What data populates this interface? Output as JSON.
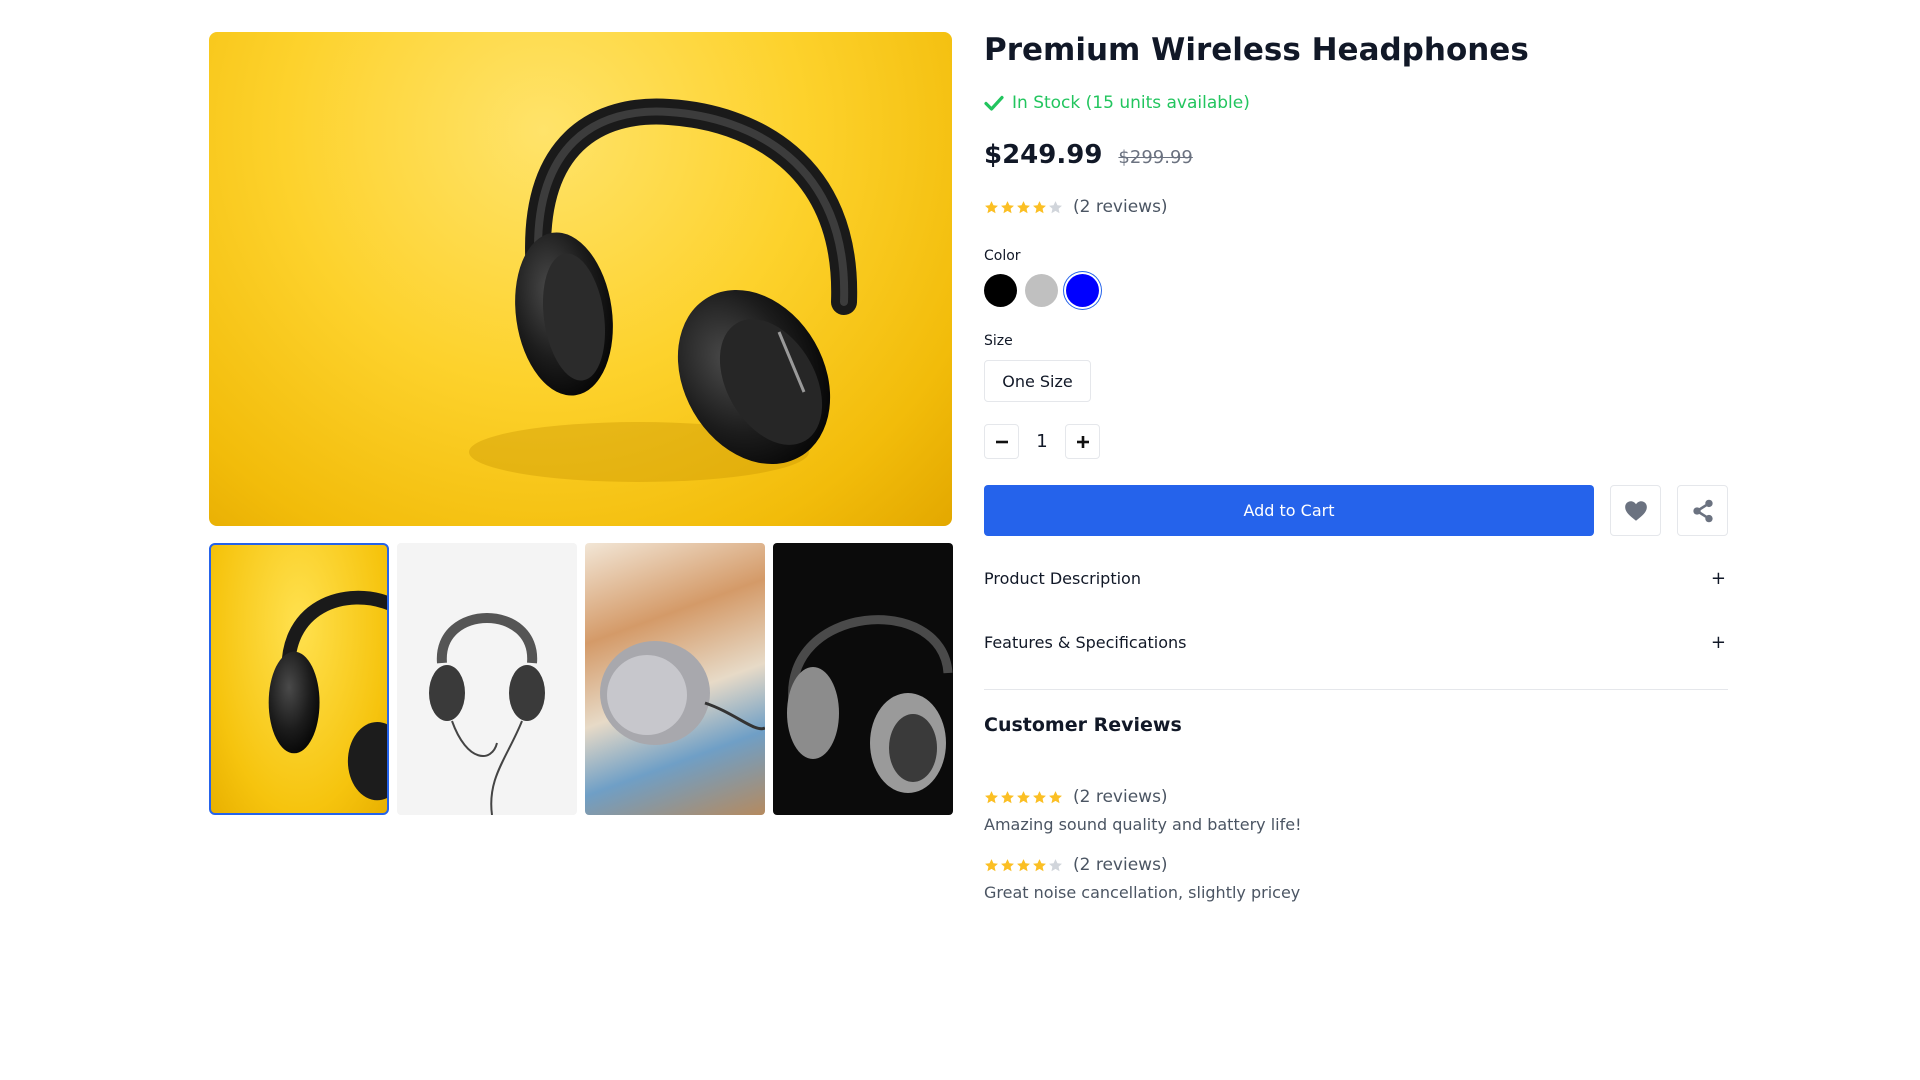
{
  "product": {
    "title": "Premium Wireless Headphones",
    "stock_text": "In Stock (15 units available)",
    "price": "$249.99",
    "old_price": "$299.99",
    "rating": 4,
    "rating_text": "(2 reviews)"
  },
  "gallery": {
    "main_image": "yellow-headphones-photo",
    "thumbnails": [
      "yellow-headphones-photo",
      "white-background-headphones-photo",
      "metal-earcup-closeup-photo",
      "black-background-headphones-photo"
    ],
    "selected_index": 0
  },
  "options": {
    "color_label": "Color",
    "colors": [
      "#000000",
      "#c0c0c0",
      "#0000ff"
    ],
    "selected_color_index": 2,
    "size_label": "Size",
    "size_value": "One Size"
  },
  "quantity": {
    "value": "1",
    "minus_icon": "minus-icon",
    "plus_icon": "plus-icon"
  },
  "actions": {
    "add_to_cart": "Add to Cart",
    "wishlist_icon": "heart-icon",
    "share_icon": "share-icon"
  },
  "accordions": {
    "description": {
      "title": "Product Description",
      "toggle": "+"
    },
    "features": {
      "title": "Features & Specifications",
      "toggle": "+"
    }
  },
  "reviews": {
    "heading": "Customer Reviews",
    "items": [
      {
        "rating": 5,
        "count_text": "(2 reviews)",
        "text": "Amazing sound quality and battery life!"
      },
      {
        "rating": 4,
        "count_text": "(2 reviews)",
        "text": "Great noise cancellation, slightly pricey"
      }
    ]
  },
  "colors": {
    "accent": "#2563eb",
    "stock_green": "#22c55e",
    "star_filled": "#fbbf24",
    "star_empty": "#d1d5db"
  }
}
